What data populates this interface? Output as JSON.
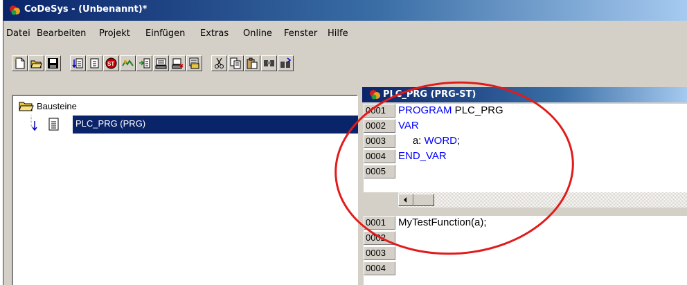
{
  "window": {
    "title": "CoDeSys - (Unbenannt)*"
  },
  "menu": [
    "Datei",
    "Bearbeiten",
    "Projekt",
    "Einfügen",
    "Extras",
    "Online",
    "Fenster",
    "Hilfe"
  ],
  "toolbar": {
    "buttons": [
      "new-icon",
      "open-icon",
      "save-icon",
      "compile-icon",
      "login-icon",
      "stop-icon",
      "step-icon",
      "watch-icon",
      "monitor-icon",
      "breakpoint-icon",
      "lib-icon",
      "cut-icon",
      "copy-icon",
      "paste-icon",
      "find-icon",
      "replace-icon"
    ]
  },
  "tree": {
    "root_label": "Bausteine",
    "items": [
      {
        "label": "PLC_PRG (PRG)",
        "selected": true
      }
    ]
  },
  "editor": {
    "title": "PLC_PRG (PRG-ST)",
    "declaration_lines": [
      {
        "num": "0001",
        "tokens": [
          {
            "t": "PROGRAM",
            "kw": true
          },
          {
            "t": " PLC_PRG",
            "kw": false
          }
        ]
      },
      {
        "num": "0002",
        "tokens": [
          {
            "t": "VAR",
            "kw": true
          }
        ]
      },
      {
        "num": "0003",
        "tokens": [
          {
            "t": "     a: ",
            "kw": false
          },
          {
            "t": "WORD",
            "kw": true
          },
          {
            "t": ";",
            "kw": false
          }
        ]
      },
      {
        "num": "0004",
        "tokens": [
          {
            "t": "END_VAR",
            "kw": true
          }
        ]
      },
      {
        "num": "0005",
        "tokens": []
      }
    ],
    "body_lines": [
      {
        "num": "0001",
        "tokens": [
          {
            "t": "MyTestFunction(a);",
            "kw": false
          }
        ]
      },
      {
        "num": "0002",
        "tokens": []
      },
      {
        "num": "0003",
        "tokens": []
      },
      {
        "num": "0004",
        "tokens": []
      }
    ]
  },
  "colors": {
    "title_bar": "#0a246a",
    "selection": "#0a246a",
    "keyword": "#0000ff",
    "annotation": "#e21a1a"
  }
}
